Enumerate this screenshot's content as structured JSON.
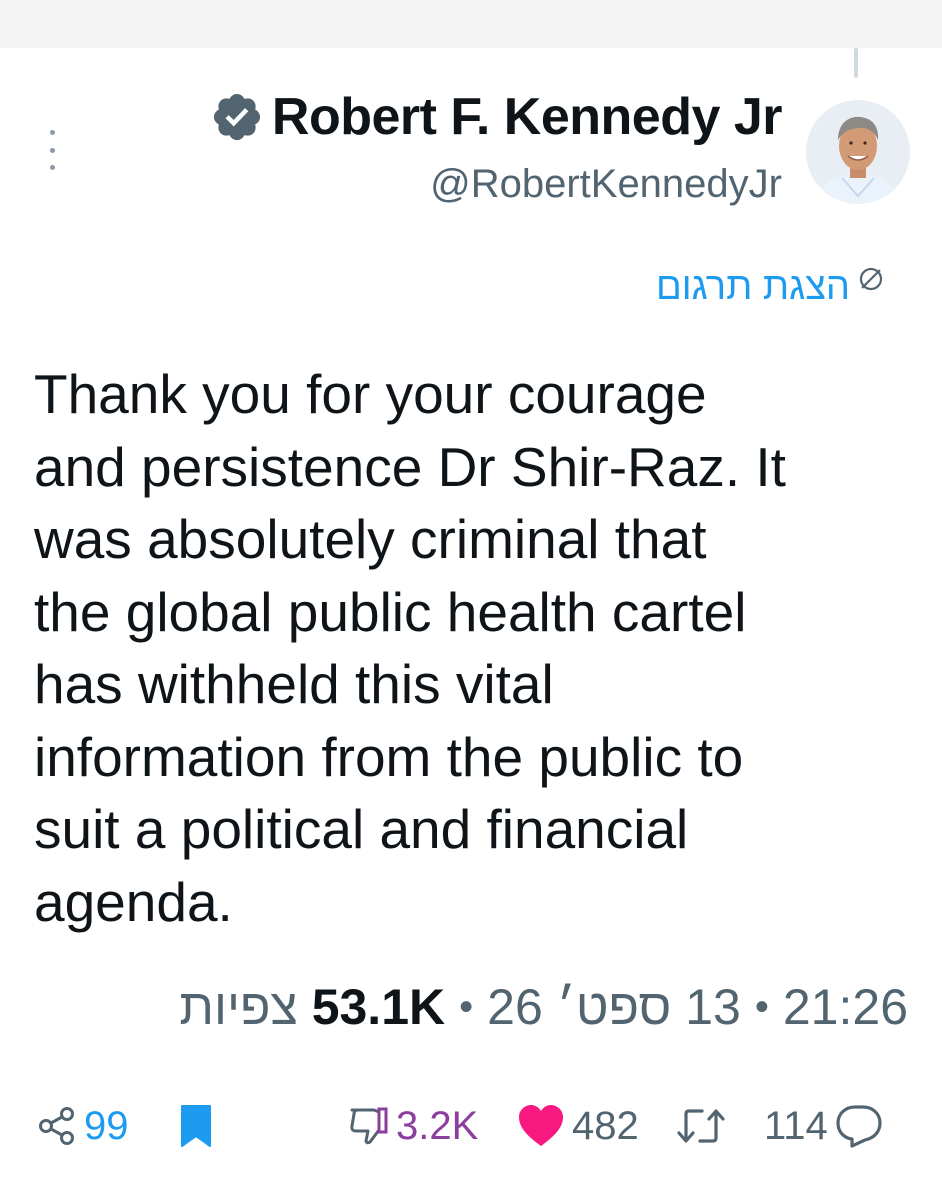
{
  "author": {
    "display_name": "Robert F. Kennedy Jr",
    "handle": "@RobertKennedyJr",
    "verified": true
  },
  "translate_label": "הצגת תרגום",
  "tweet": {
    "text": "Thank you for your courage\nand persistence Dr Shir-Raz. It\nwas absolutely criminal that\nthe global public health cartel\nhas withheld this vital\ninformation from the public to\nsuit a political and financial\nagenda."
  },
  "meta": {
    "time": "21:26",
    "date": "13 ספט׳ 26",
    "separator": "•",
    "views_count": "53.1K",
    "views_label": "צפיות"
  },
  "actions": {
    "share_count": "99",
    "dislike_count": "3.2K",
    "like_count": "482",
    "retweet_count": "114"
  },
  "colors": {
    "accent": "#1d9bf0",
    "like": "#f91880",
    "dislike": "#8b3e9d",
    "verified": "#536471",
    "text": "#0f1419",
    "muted": "#536471"
  },
  "icons": [
    "more-vertical-icon",
    "verified-badge-icon",
    "globe-icon",
    "share-icon",
    "bookmark-icon",
    "dislike-icon",
    "heart-icon",
    "retweet-icon",
    "reply-icon"
  ]
}
